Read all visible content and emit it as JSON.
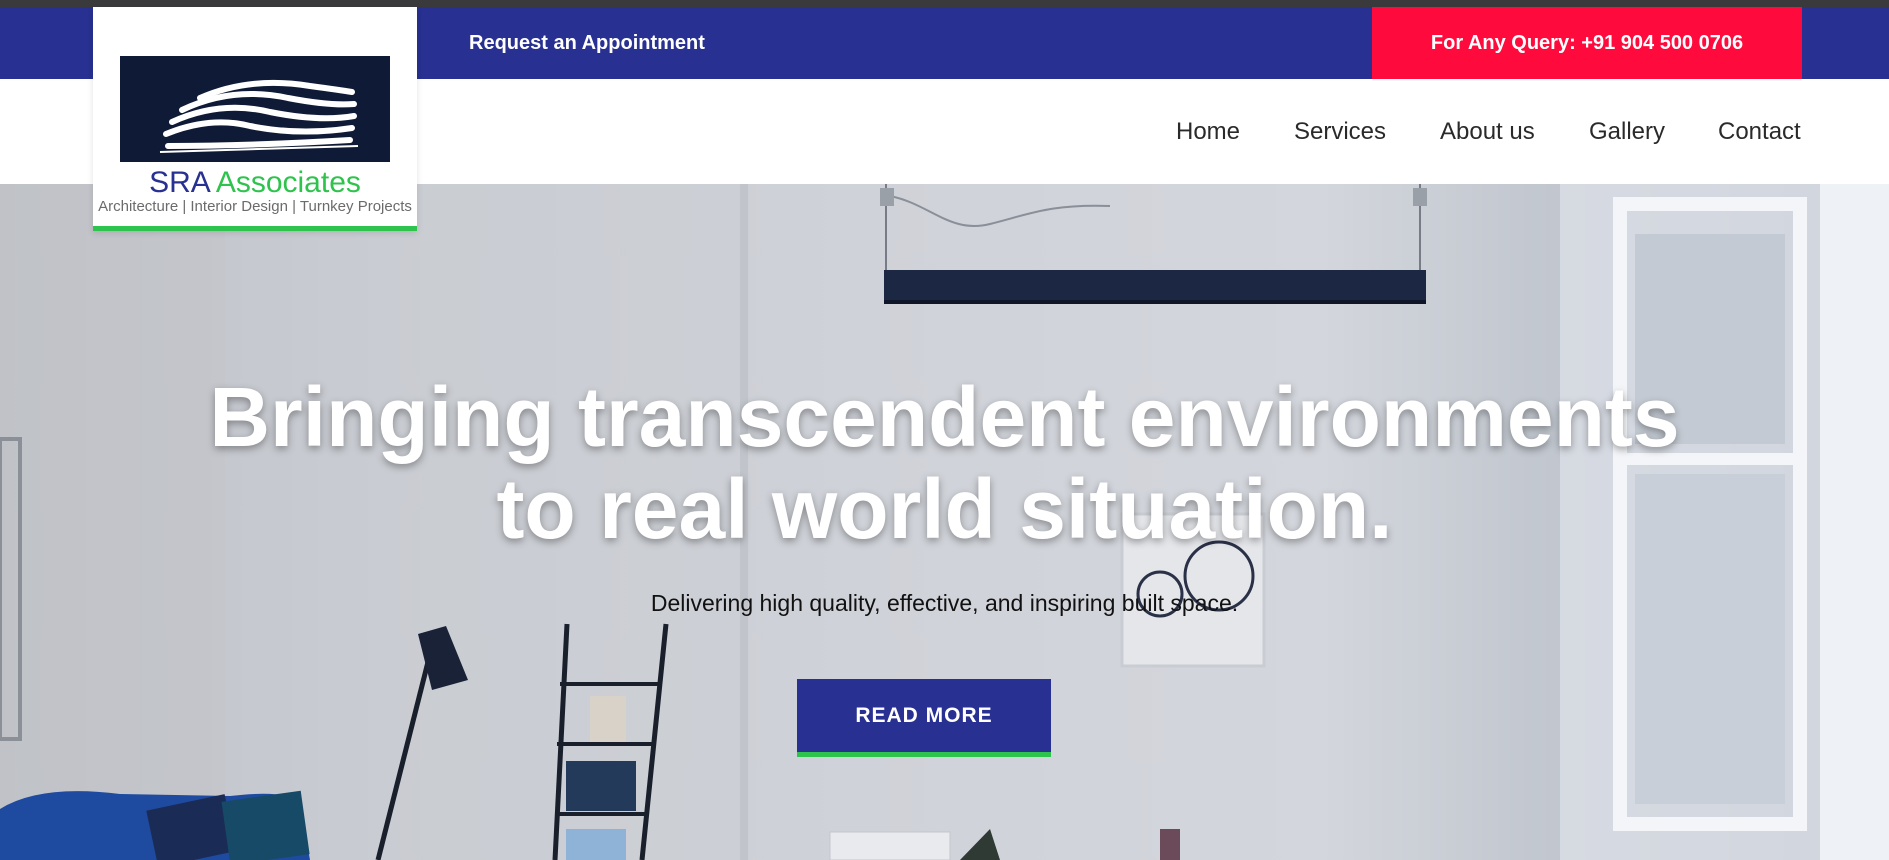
{
  "topbar": {
    "appointment_label": "Request an Appointment",
    "query_label": "For Any Query: +91 904 500 0706"
  },
  "logo": {
    "name_part1": "SRA",
    "name_part2": "Associates",
    "tagline": "Architecture | Interior Design | Turnkey Projects"
  },
  "nav": {
    "items": [
      {
        "label": "Home"
      },
      {
        "label": "Services"
      },
      {
        "label": "About us"
      },
      {
        "label": "Gallery"
      },
      {
        "label": "Contact"
      }
    ]
  },
  "hero": {
    "title_line1": "Bringing transcendent environments",
    "title_line2": "to real world situation.",
    "subtitle": "Delivering high quality, effective, and inspiring built space.",
    "button_label": "READ MORE"
  },
  "colors": {
    "brand_blue": "#283091",
    "brand_green": "#2ec34c",
    "query_red": "#ff0a3c"
  },
  "icons": {
    "logo_mark": "building-wave-logo-icon"
  }
}
